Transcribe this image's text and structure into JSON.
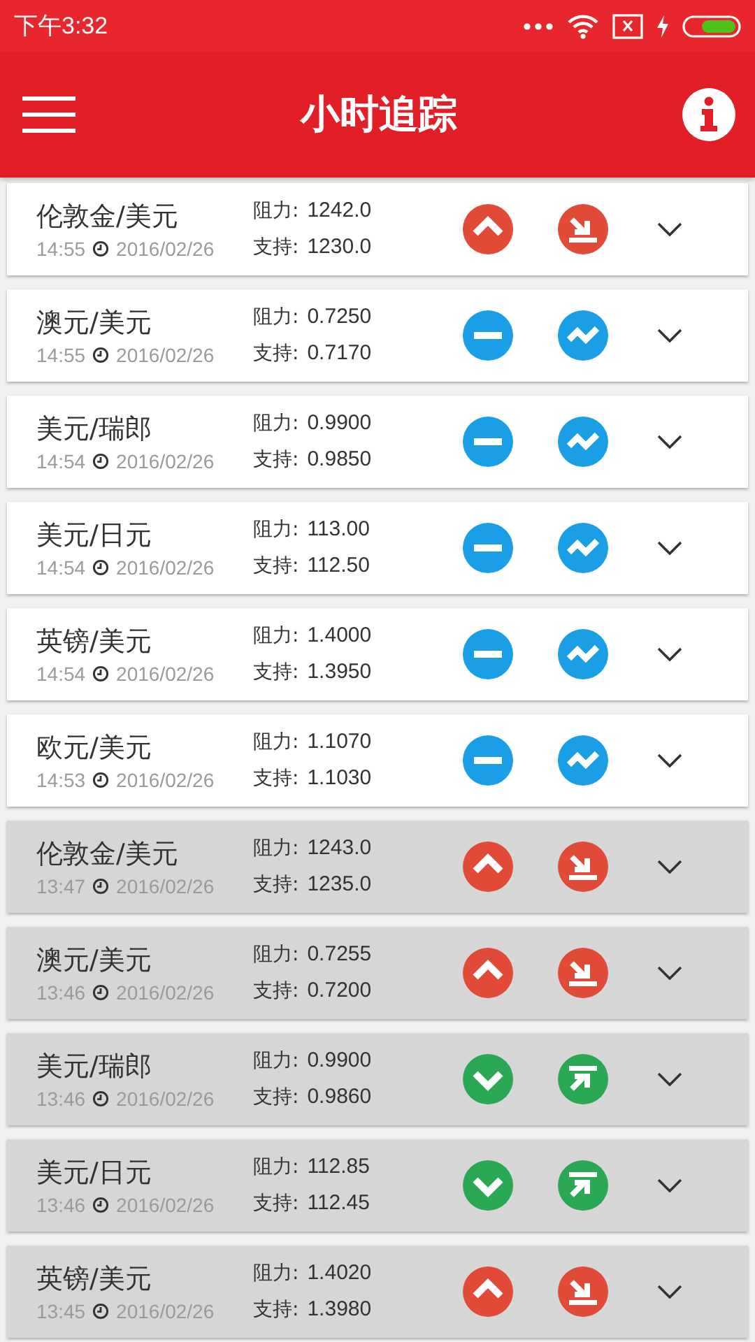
{
  "status_bar": {
    "time": "下午3:32"
  },
  "app_bar": {
    "title": "小时追踪"
  },
  "rows": [
    {
      "pair": "伦敦金/美元",
      "time": "14:55",
      "date": "2016/02/26",
      "resistance_label": "阻力:",
      "resistance": "1242.0",
      "support_label": "支持:",
      "support": "1230.0",
      "kind": "up",
      "older": false
    },
    {
      "pair": "澳元/美元",
      "time": "14:55",
      "date": "2016/02/26",
      "resistance_label": "阻力:",
      "resistance": "0.7250",
      "support_label": "支持:",
      "support": "0.7170",
      "kind": "flat",
      "older": false
    },
    {
      "pair": "美元/瑞郎",
      "time": "14:54",
      "date": "2016/02/26",
      "resistance_label": "阻力:",
      "resistance": "0.9900",
      "support_label": "支持:",
      "support": "0.9850",
      "kind": "flat",
      "older": false
    },
    {
      "pair": "美元/日元",
      "time": "14:54",
      "date": "2016/02/26",
      "resistance_label": "阻力:",
      "resistance": "113.00",
      "support_label": "支持:",
      "support": "112.50",
      "kind": "flat",
      "older": false
    },
    {
      "pair": "英镑/美元",
      "time": "14:54",
      "date": "2016/02/26",
      "resistance_label": "阻力:",
      "resistance": "1.4000",
      "support_label": "支持:",
      "support": "1.3950",
      "kind": "flat",
      "older": false
    },
    {
      "pair": "欧元/美元",
      "time": "14:53",
      "date": "2016/02/26",
      "resistance_label": "阻力:",
      "resistance": "1.1070",
      "support_label": "支持:",
      "support": "1.1030",
      "kind": "flat",
      "older": false
    },
    {
      "pair": "伦敦金/美元",
      "time": "13:47",
      "date": "2016/02/26",
      "resistance_label": "阻力:",
      "resistance": "1243.0",
      "support_label": "支持:",
      "support": "1235.0",
      "kind": "up",
      "older": true
    },
    {
      "pair": "澳元/美元",
      "time": "13:46",
      "date": "2016/02/26",
      "resistance_label": "阻力:",
      "resistance": "0.7255",
      "support_label": "支持:",
      "support": "0.7200",
      "kind": "up",
      "older": true
    },
    {
      "pair": "美元/瑞郎",
      "time": "13:46",
      "date": "2016/02/26",
      "resistance_label": "阻力:",
      "resistance": "0.9900",
      "support_label": "支持:",
      "support": "0.9860",
      "kind": "down",
      "older": true
    },
    {
      "pair": "美元/日元",
      "time": "13:46",
      "date": "2016/02/26",
      "resistance_label": "阻力:",
      "resistance": "112.85",
      "support_label": "支持:",
      "support": "112.45",
      "kind": "down",
      "older": true
    },
    {
      "pair": "英镑/美元",
      "time": "13:45",
      "date": "2016/02/26",
      "resistance_label": "阻力:",
      "resistance": "1.4020",
      "support_label": "支持:",
      "support": "1.3980",
      "kind": "up",
      "older": true
    }
  ]
}
